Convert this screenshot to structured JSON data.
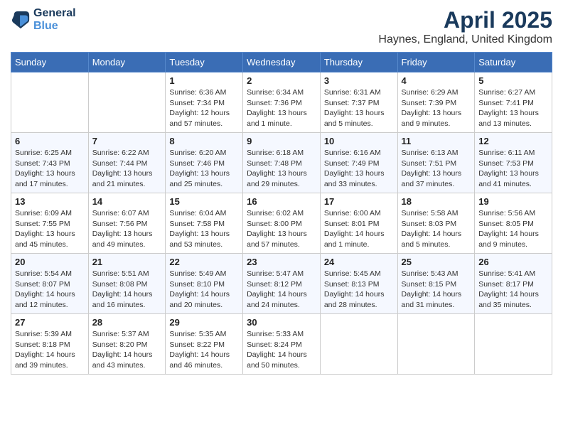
{
  "logo": {
    "line1": "General",
    "line2": "Blue"
  },
  "title": "April 2025",
  "location": "Haynes, England, United Kingdom",
  "days_header": [
    "Sunday",
    "Monday",
    "Tuesday",
    "Wednesday",
    "Thursday",
    "Friday",
    "Saturday"
  ],
  "weeks": [
    [
      {
        "day": "",
        "sunrise": "",
        "sunset": "",
        "daylight": ""
      },
      {
        "day": "",
        "sunrise": "",
        "sunset": "",
        "daylight": ""
      },
      {
        "day": "1",
        "sunrise": "Sunrise: 6:36 AM",
        "sunset": "Sunset: 7:34 PM",
        "daylight": "Daylight: 12 hours and 57 minutes."
      },
      {
        "day": "2",
        "sunrise": "Sunrise: 6:34 AM",
        "sunset": "Sunset: 7:36 PM",
        "daylight": "Daylight: 13 hours and 1 minute."
      },
      {
        "day": "3",
        "sunrise": "Sunrise: 6:31 AM",
        "sunset": "Sunset: 7:37 PM",
        "daylight": "Daylight: 13 hours and 5 minutes."
      },
      {
        "day": "4",
        "sunrise": "Sunrise: 6:29 AM",
        "sunset": "Sunset: 7:39 PM",
        "daylight": "Daylight: 13 hours and 9 minutes."
      },
      {
        "day": "5",
        "sunrise": "Sunrise: 6:27 AM",
        "sunset": "Sunset: 7:41 PM",
        "daylight": "Daylight: 13 hours and 13 minutes."
      }
    ],
    [
      {
        "day": "6",
        "sunrise": "Sunrise: 6:25 AM",
        "sunset": "Sunset: 7:43 PM",
        "daylight": "Daylight: 13 hours and 17 minutes."
      },
      {
        "day": "7",
        "sunrise": "Sunrise: 6:22 AM",
        "sunset": "Sunset: 7:44 PM",
        "daylight": "Daylight: 13 hours and 21 minutes."
      },
      {
        "day": "8",
        "sunrise": "Sunrise: 6:20 AM",
        "sunset": "Sunset: 7:46 PM",
        "daylight": "Daylight: 13 hours and 25 minutes."
      },
      {
        "day": "9",
        "sunrise": "Sunrise: 6:18 AM",
        "sunset": "Sunset: 7:48 PM",
        "daylight": "Daylight: 13 hours and 29 minutes."
      },
      {
        "day": "10",
        "sunrise": "Sunrise: 6:16 AM",
        "sunset": "Sunset: 7:49 PM",
        "daylight": "Daylight: 13 hours and 33 minutes."
      },
      {
        "day": "11",
        "sunrise": "Sunrise: 6:13 AM",
        "sunset": "Sunset: 7:51 PM",
        "daylight": "Daylight: 13 hours and 37 minutes."
      },
      {
        "day": "12",
        "sunrise": "Sunrise: 6:11 AM",
        "sunset": "Sunset: 7:53 PM",
        "daylight": "Daylight: 13 hours and 41 minutes."
      }
    ],
    [
      {
        "day": "13",
        "sunrise": "Sunrise: 6:09 AM",
        "sunset": "Sunset: 7:55 PM",
        "daylight": "Daylight: 13 hours and 45 minutes."
      },
      {
        "day": "14",
        "sunrise": "Sunrise: 6:07 AM",
        "sunset": "Sunset: 7:56 PM",
        "daylight": "Daylight: 13 hours and 49 minutes."
      },
      {
        "day": "15",
        "sunrise": "Sunrise: 6:04 AM",
        "sunset": "Sunset: 7:58 PM",
        "daylight": "Daylight: 13 hours and 53 minutes."
      },
      {
        "day": "16",
        "sunrise": "Sunrise: 6:02 AM",
        "sunset": "Sunset: 8:00 PM",
        "daylight": "Daylight: 13 hours and 57 minutes."
      },
      {
        "day": "17",
        "sunrise": "Sunrise: 6:00 AM",
        "sunset": "Sunset: 8:01 PM",
        "daylight": "Daylight: 14 hours and 1 minute."
      },
      {
        "day": "18",
        "sunrise": "Sunrise: 5:58 AM",
        "sunset": "Sunset: 8:03 PM",
        "daylight": "Daylight: 14 hours and 5 minutes."
      },
      {
        "day": "19",
        "sunrise": "Sunrise: 5:56 AM",
        "sunset": "Sunset: 8:05 PM",
        "daylight": "Daylight: 14 hours and 9 minutes."
      }
    ],
    [
      {
        "day": "20",
        "sunrise": "Sunrise: 5:54 AM",
        "sunset": "Sunset: 8:07 PM",
        "daylight": "Daylight: 14 hours and 12 minutes."
      },
      {
        "day": "21",
        "sunrise": "Sunrise: 5:51 AM",
        "sunset": "Sunset: 8:08 PM",
        "daylight": "Daylight: 14 hours and 16 minutes."
      },
      {
        "day": "22",
        "sunrise": "Sunrise: 5:49 AM",
        "sunset": "Sunset: 8:10 PM",
        "daylight": "Daylight: 14 hours and 20 minutes."
      },
      {
        "day": "23",
        "sunrise": "Sunrise: 5:47 AM",
        "sunset": "Sunset: 8:12 PM",
        "daylight": "Daylight: 14 hours and 24 minutes."
      },
      {
        "day": "24",
        "sunrise": "Sunrise: 5:45 AM",
        "sunset": "Sunset: 8:13 PM",
        "daylight": "Daylight: 14 hours and 28 minutes."
      },
      {
        "day": "25",
        "sunrise": "Sunrise: 5:43 AM",
        "sunset": "Sunset: 8:15 PM",
        "daylight": "Daylight: 14 hours and 31 minutes."
      },
      {
        "day": "26",
        "sunrise": "Sunrise: 5:41 AM",
        "sunset": "Sunset: 8:17 PM",
        "daylight": "Daylight: 14 hours and 35 minutes."
      }
    ],
    [
      {
        "day": "27",
        "sunrise": "Sunrise: 5:39 AM",
        "sunset": "Sunset: 8:18 PM",
        "daylight": "Daylight: 14 hours and 39 minutes."
      },
      {
        "day": "28",
        "sunrise": "Sunrise: 5:37 AM",
        "sunset": "Sunset: 8:20 PM",
        "daylight": "Daylight: 14 hours and 43 minutes."
      },
      {
        "day": "29",
        "sunrise": "Sunrise: 5:35 AM",
        "sunset": "Sunset: 8:22 PM",
        "daylight": "Daylight: 14 hours and 46 minutes."
      },
      {
        "day": "30",
        "sunrise": "Sunrise: 5:33 AM",
        "sunset": "Sunset: 8:24 PM",
        "daylight": "Daylight: 14 hours and 50 minutes."
      },
      {
        "day": "",
        "sunrise": "",
        "sunset": "",
        "daylight": ""
      },
      {
        "day": "",
        "sunrise": "",
        "sunset": "",
        "daylight": ""
      },
      {
        "day": "",
        "sunrise": "",
        "sunset": "",
        "daylight": ""
      }
    ]
  ]
}
